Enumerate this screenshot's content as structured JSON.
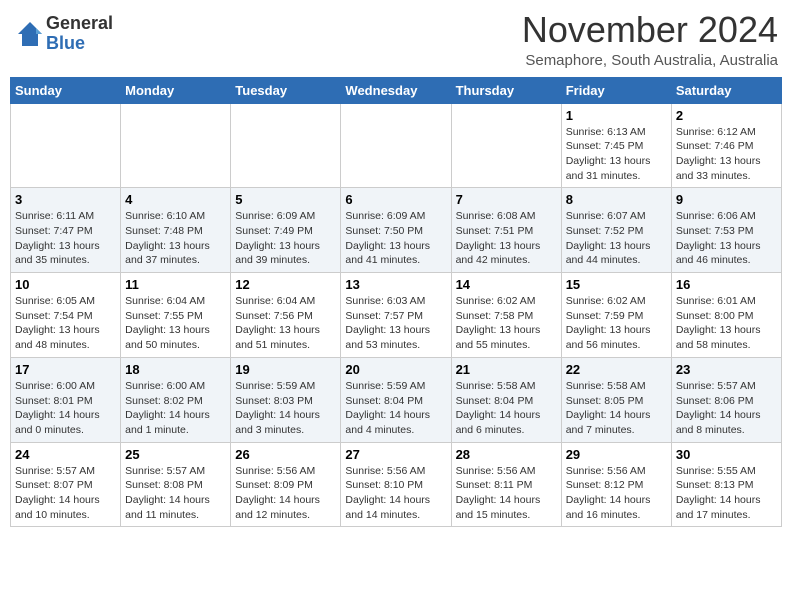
{
  "header": {
    "logo_general": "General",
    "logo_blue": "Blue",
    "month_title": "November 2024",
    "subtitle": "Semaphore, South Australia, Australia"
  },
  "days_of_week": [
    "Sunday",
    "Monday",
    "Tuesday",
    "Wednesday",
    "Thursday",
    "Friday",
    "Saturday"
  ],
  "weeks": [
    [
      {
        "day": "",
        "info": ""
      },
      {
        "day": "",
        "info": ""
      },
      {
        "day": "",
        "info": ""
      },
      {
        "day": "",
        "info": ""
      },
      {
        "day": "",
        "info": ""
      },
      {
        "day": "1",
        "info": "Sunrise: 6:13 AM\nSunset: 7:45 PM\nDaylight: 13 hours and 31 minutes."
      },
      {
        "day": "2",
        "info": "Sunrise: 6:12 AM\nSunset: 7:46 PM\nDaylight: 13 hours and 33 minutes."
      }
    ],
    [
      {
        "day": "3",
        "info": "Sunrise: 6:11 AM\nSunset: 7:47 PM\nDaylight: 13 hours and 35 minutes."
      },
      {
        "day": "4",
        "info": "Sunrise: 6:10 AM\nSunset: 7:48 PM\nDaylight: 13 hours and 37 minutes."
      },
      {
        "day": "5",
        "info": "Sunrise: 6:09 AM\nSunset: 7:49 PM\nDaylight: 13 hours and 39 minutes."
      },
      {
        "day": "6",
        "info": "Sunrise: 6:09 AM\nSunset: 7:50 PM\nDaylight: 13 hours and 41 minutes."
      },
      {
        "day": "7",
        "info": "Sunrise: 6:08 AM\nSunset: 7:51 PM\nDaylight: 13 hours and 42 minutes."
      },
      {
        "day": "8",
        "info": "Sunrise: 6:07 AM\nSunset: 7:52 PM\nDaylight: 13 hours and 44 minutes."
      },
      {
        "day": "9",
        "info": "Sunrise: 6:06 AM\nSunset: 7:53 PM\nDaylight: 13 hours and 46 minutes."
      }
    ],
    [
      {
        "day": "10",
        "info": "Sunrise: 6:05 AM\nSunset: 7:54 PM\nDaylight: 13 hours and 48 minutes."
      },
      {
        "day": "11",
        "info": "Sunrise: 6:04 AM\nSunset: 7:55 PM\nDaylight: 13 hours and 50 minutes."
      },
      {
        "day": "12",
        "info": "Sunrise: 6:04 AM\nSunset: 7:56 PM\nDaylight: 13 hours and 51 minutes."
      },
      {
        "day": "13",
        "info": "Sunrise: 6:03 AM\nSunset: 7:57 PM\nDaylight: 13 hours and 53 minutes."
      },
      {
        "day": "14",
        "info": "Sunrise: 6:02 AM\nSunset: 7:58 PM\nDaylight: 13 hours and 55 minutes."
      },
      {
        "day": "15",
        "info": "Sunrise: 6:02 AM\nSunset: 7:59 PM\nDaylight: 13 hours and 56 minutes."
      },
      {
        "day": "16",
        "info": "Sunrise: 6:01 AM\nSunset: 8:00 PM\nDaylight: 13 hours and 58 minutes."
      }
    ],
    [
      {
        "day": "17",
        "info": "Sunrise: 6:00 AM\nSunset: 8:01 PM\nDaylight: 14 hours and 0 minutes."
      },
      {
        "day": "18",
        "info": "Sunrise: 6:00 AM\nSunset: 8:02 PM\nDaylight: 14 hours and 1 minute."
      },
      {
        "day": "19",
        "info": "Sunrise: 5:59 AM\nSunset: 8:03 PM\nDaylight: 14 hours and 3 minutes."
      },
      {
        "day": "20",
        "info": "Sunrise: 5:59 AM\nSunset: 8:04 PM\nDaylight: 14 hours and 4 minutes."
      },
      {
        "day": "21",
        "info": "Sunrise: 5:58 AM\nSunset: 8:04 PM\nDaylight: 14 hours and 6 minutes."
      },
      {
        "day": "22",
        "info": "Sunrise: 5:58 AM\nSunset: 8:05 PM\nDaylight: 14 hours and 7 minutes."
      },
      {
        "day": "23",
        "info": "Sunrise: 5:57 AM\nSunset: 8:06 PM\nDaylight: 14 hours and 8 minutes."
      }
    ],
    [
      {
        "day": "24",
        "info": "Sunrise: 5:57 AM\nSunset: 8:07 PM\nDaylight: 14 hours and 10 minutes."
      },
      {
        "day": "25",
        "info": "Sunrise: 5:57 AM\nSunset: 8:08 PM\nDaylight: 14 hours and 11 minutes."
      },
      {
        "day": "26",
        "info": "Sunrise: 5:56 AM\nSunset: 8:09 PM\nDaylight: 14 hours and 12 minutes."
      },
      {
        "day": "27",
        "info": "Sunrise: 5:56 AM\nSunset: 8:10 PM\nDaylight: 14 hours and 14 minutes."
      },
      {
        "day": "28",
        "info": "Sunrise: 5:56 AM\nSunset: 8:11 PM\nDaylight: 14 hours and 15 minutes."
      },
      {
        "day": "29",
        "info": "Sunrise: 5:56 AM\nSunset: 8:12 PM\nDaylight: 14 hours and 16 minutes."
      },
      {
        "day": "30",
        "info": "Sunrise: 5:55 AM\nSunset: 8:13 PM\nDaylight: 14 hours and 17 minutes."
      }
    ]
  ]
}
